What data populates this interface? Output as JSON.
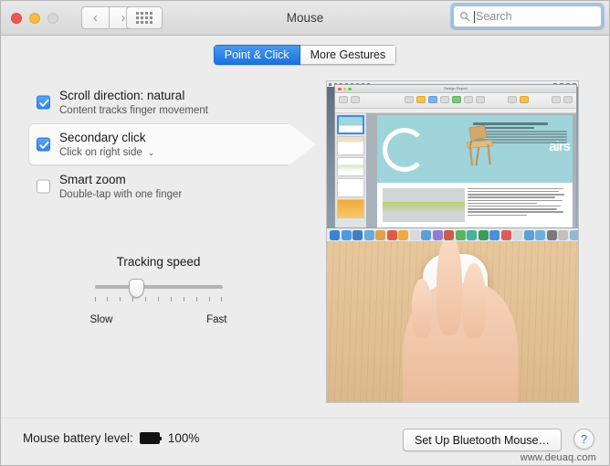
{
  "window": {
    "title": "Mouse",
    "traffic_lights": [
      "close",
      "minimize",
      "zoom"
    ],
    "nav": {
      "back": "‹",
      "forward": "›"
    },
    "grid_button": "show-all"
  },
  "search": {
    "placeholder": "Search",
    "value": "",
    "icon": "search-icon"
  },
  "tabs": [
    {
      "label": "Point & Click",
      "active": true
    },
    {
      "label": "More Gestures",
      "active": false
    }
  ],
  "options": [
    {
      "title": "Scroll direction: natural",
      "subtitle": "Content tracks finger movement",
      "checked": true,
      "selected": false,
      "has_popup": false
    },
    {
      "title": "Secondary click",
      "subtitle": "Click on right side",
      "checked": true,
      "selected": true,
      "has_popup": true,
      "popup_chevron": "⌄"
    },
    {
      "title": "Smart zoom",
      "subtitle": "Double-tap with one finger",
      "checked": false,
      "selected": false,
      "has_popup": false
    }
  ],
  "slider": {
    "title": "Tracking speed",
    "min_label": "Slow",
    "max_label": "Fast",
    "value_percent": 33,
    "tick_count": 11
  },
  "preview": {
    "top_caption": "pages-document-screenshot",
    "bottom_caption": "hand-on-magic-mouse-photo",
    "document_title": "Design Report",
    "hero_word": "airs",
    "dock_colors": [
      "#3b82d6",
      "#4a9be0",
      "#3f7fc4",
      "#6aa8e2",
      "#e0a24a",
      "#e05a4a",
      "#f0a93c",
      "#d9d9d9",
      "#5aa0d8",
      "#8f7fd0",
      "#d05a4a",
      "#5ab45a",
      "#49b0a0",
      "#3d9b57",
      "#4a8fd8",
      "#e05a5a",
      "#d8d8d8",
      "#5aa0d8",
      "#6fb0e0",
      "#7a7a7a",
      "#c0c0c0",
      "#8fb8d8",
      "#d8d8d8"
    ]
  },
  "bottom": {
    "battery_label": "Mouse battery level:",
    "battery_percent": "100%",
    "battery_icon": "battery-full-icon",
    "setup_button": "Set Up Bluetooth Mouse…",
    "help_button": "?",
    "watermark": "www.deuaq.com"
  },
  "colors": {
    "accent_blue": "#2e86ef",
    "tab_blue": "#1a72e0",
    "window_bg": "#ececec",
    "help_blue": "#2a7ad6"
  }
}
